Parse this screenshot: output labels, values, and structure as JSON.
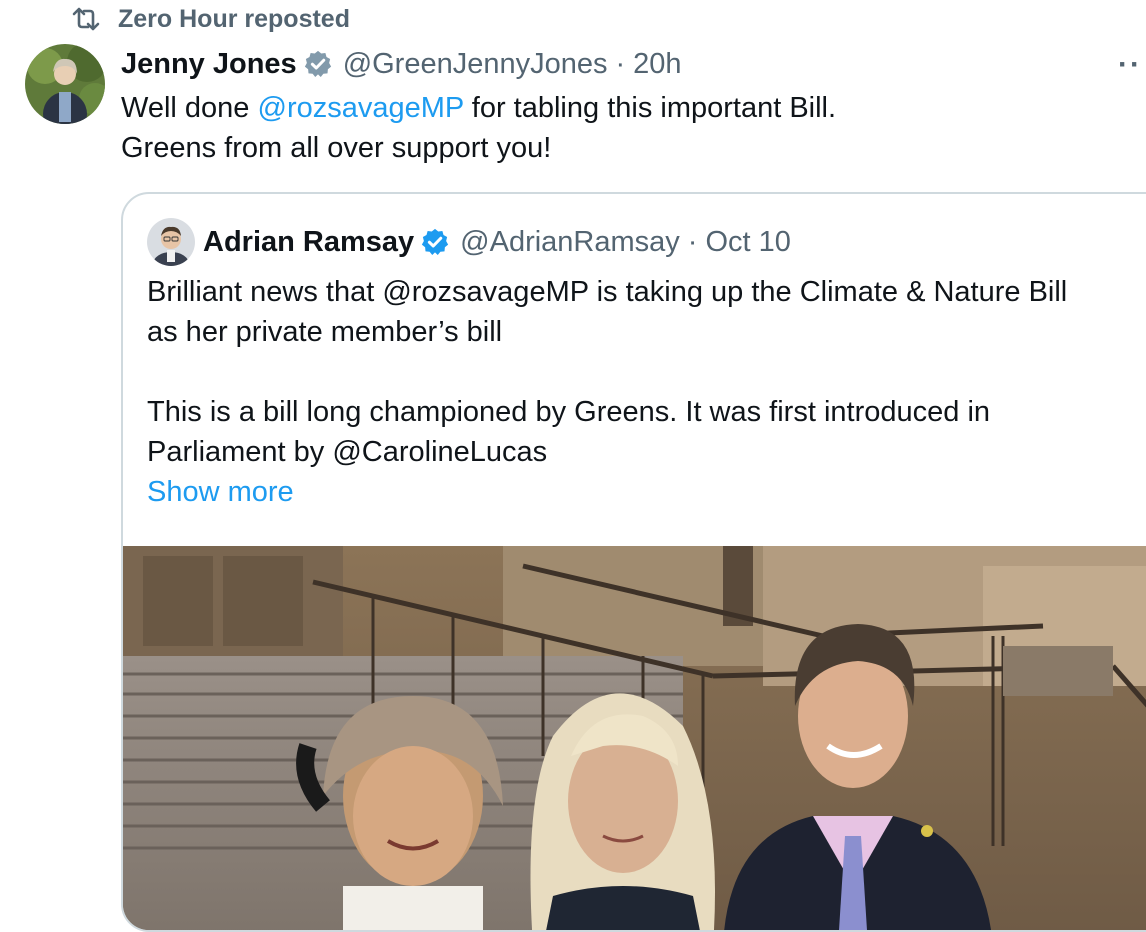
{
  "repost": {
    "label": "Zero Hour reposted",
    "icon": "repost-icon"
  },
  "tweet": {
    "author_name": "Jenny Jones",
    "handle": "@GreenJennyJones",
    "separator": "·",
    "time": "20h",
    "more_label": "··",
    "text_line1_prefix": "Well done ",
    "text_line1_mention": "@rozsavageMP",
    "text_line1_suffix": " for tabling this important Bill.",
    "text_line2": "Greens from all over support you!"
  },
  "quote": {
    "author_name": "Adrian Ramsay",
    "handle": "@AdrianRamsay",
    "separator": "·",
    "date": "Oct 10",
    "line1": "Brilliant news that @rozsavageMP is taking up the Climate & Nature Bill",
    "line2": "as her private member’s bill",
    "line3": "This is a bill long championed by Greens. It was first introduced in",
    "line4": "Parliament by @CarolineLucas",
    "show_more": "Show more"
  },
  "colors": {
    "accent": "#1d9bf0",
    "secondary_text": "#536471",
    "border": "#cfd9de",
    "verified_grey": "#829aab",
    "verified_blue": "#1d9bf0"
  }
}
